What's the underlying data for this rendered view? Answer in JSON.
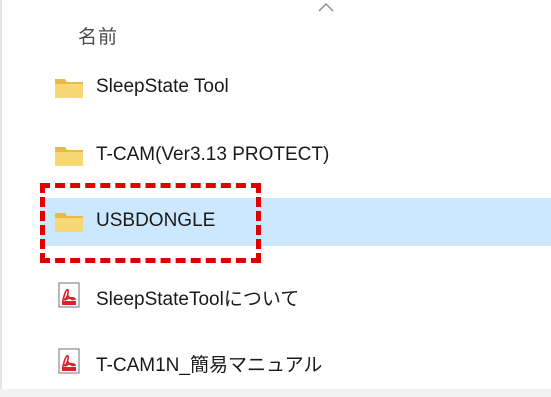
{
  "header": {
    "name_column_label": "名前",
    "sort_indicator_icon": "chevron-up-icon"
  },
  "files": [
    {
      "name": "SleepState Tool",
      "type": "folder",
      "icon": "folder-icon",
      "selected": false
    },
    {
      "name": "T-CAM(Ver3.13 PROTECT)",
      "type": "folder",
      "icon": "folder-icon",
      "selected": false
    },
    {
      "name": "USBDONGLE",
      "type": "folder",
      "icon": "folder-icon",
      "selected": true
    },
    {
      "name": "SleepStateToolについて",
      "type": "pdf",
      "icon": "pdf-icon",
      "selected": false
    },
    {
      "name": "T-CAM1N_簡易マニュアル",
      "type": "pdf",
      "icon": "pdf-icon",
      "selected": false
    }
  ],
  "colors": {
    "selection_bg": "#cce8ff",
    "folder": "#f8d775",
    "folder_dark": "#e9b949",
    "pdf_red": "#d9232e",
    "highlight_border": "#e00000"
  }
}
